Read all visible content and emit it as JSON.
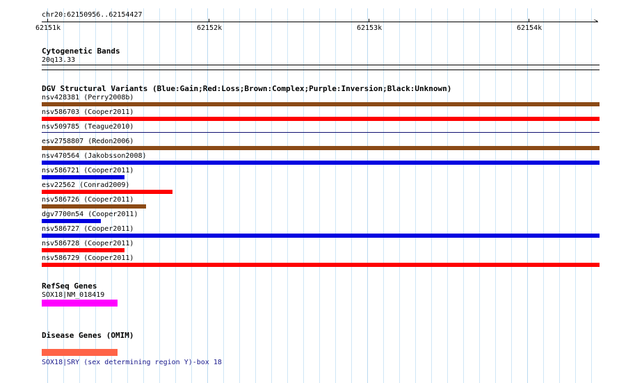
{
  "ruler": {
    "region": "chr20:62150956..62154427",
    "ticks": [
      "62151k",
      "62152k",
      "62153k",
      "62154k"
    ]
  },
  "cytoband": {
    "title": "Cytogenetic Bands",
    "band": "20q13.33"
  },
  "dgv": {
    "title": "DGV Structural Variants (Blue:Gain;Red:Loss;Brown:Complex;Purple:Inversion;Black:Unknown)",
    "colors": {
      "gain": "#0000e0",
      "loss": "#ff0000",
      "complex": "#8b4a16",
      "purple": "#800080",
      "unknown": "#000000",
      "other": "#101070"
    },
    "variants": [
      {
        "label": "nsv428381 (Perry2008b)",
        "type": "complex"
      },
      {
        "label": "nsv586703 (Cooper2011)",
        "type": "loss"
      },
      {
        "label": "nsv509785 (Teague2010)",
        "type": "other"
      },
      {
        "label": "esv2758807 (Redon2006)",
        "type": "complex"
      },
      {
        "label": "nsv470564 (Jakobsson2008)",
        "type": "gain"
      },
      {
        "label": "nsv586721 (Cooper2011)",
        "type": "gain"
      },
      {
        "label": "esv22562 (Conrad2009)",
        "type": "loss"
      },
      {
        "label": "nsv586726 (Cooper2011)",
        "type": "complex"
      },
      {
        "label": "dgv7700n54 (Cooper2011)",
        "type": "gain"
      },
      {
        "label": "nsv586727 (Cooper2011)",
        "type": "gain"
      },
      {
        "label": "nsv586728 (Cooper2011)",
        "type": "loss"
      },
      {
        "label": "nsv586729 (Cooper2011)",
        "type": "loss"
      }
    ]
  },
  "refseq": {
    "title": "RefSeq Genes",
    "gene_label": "SOX18|NM_018419",
    "color": "#ff00ff"
  },
  "omim": {
    "title": "Disease Genes (OMIM)",
    "gene_label": "SOX18|SRY (sex determining region Y)-box 18",
    "color": "#ff6347"
  }
}
